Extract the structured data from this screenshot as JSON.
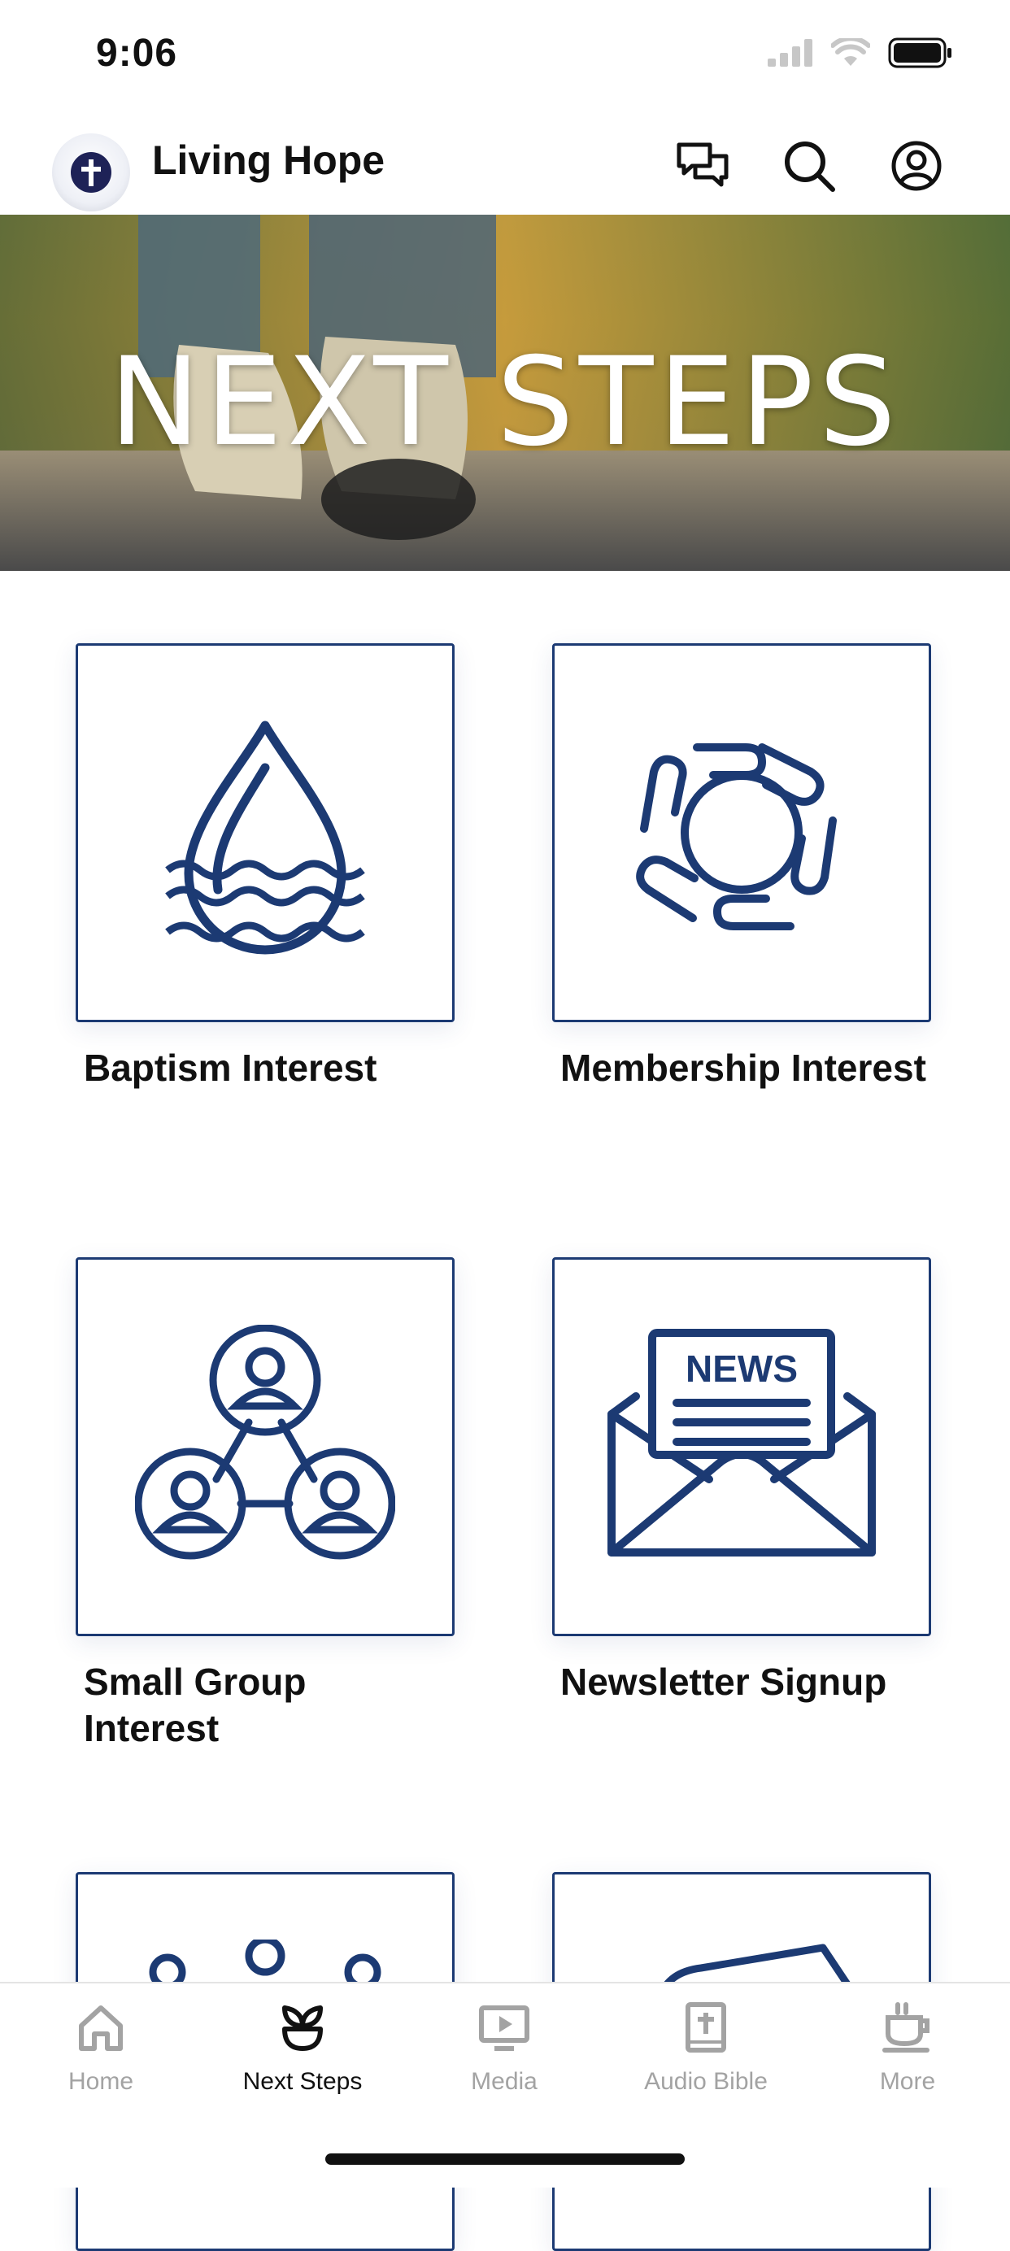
{
  "status_bar": {
    "time": "9:06"
  },
  "header": {
    "title": "Living Hope"
  },
  "hero": {
    "title": "NEXT STEPS"
  },
  "cards": [
    {
      "label": "Baptism Interest",
      "icon": "water-drop-icon"
    },
    {
      "label": "Membership Interest",
      "icon": "joined-hands-icon"
    },
    {
      "label": "Small Group Interest",
      "icon": "group-network-icon"
    },
    {
      "label": "Newsletter Signup",
      "icon": "newsletter-envelope-icon",
      "icon_text": "NEWS"
    },
    {
      "label": "",
      "icon": "people-partial-icon"
    },
    {
      "label": "",
      "icon": "bible-partial-icon"
    }
  ],
  "tabs": [
    {
      "label": "Home",
      "icon": "home-icon",
      "active": false
    },
    {
      "label": "Next Steps",
      "icon": "plant-icon",
      "active": true
    },
    {
      "label": "Media",
      "icon": "media-play-icon",
      "active": false
    },
    {
      "label": "Audio Bible",
      "icon": "bible-icon",
      "active": false
    },
    {
      "label": "More",
      "icon": "coffee-cup-icon",
      "active": false
    }
  ],
  "colors": {
    "accent": "#1c3a73",
    "inactive_tab": "#a3a3a3",
    "active_tab": "#111111"
  }
}
